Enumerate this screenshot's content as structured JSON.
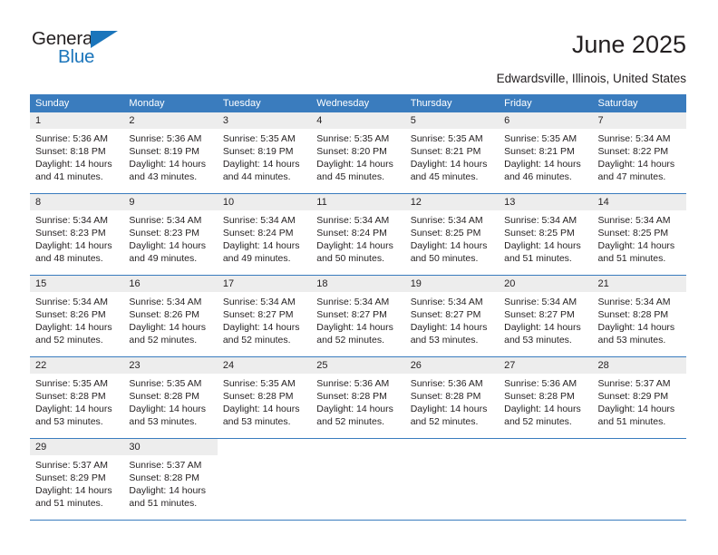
{
  "brand": {
    "name_dark": "General",
    "name_blue": "Blue",
    "accent_color": "#1b75bb"
  },
  "header": {
    "title": "June 2025",
    "subtitle": "Edwardsville, Illinois, United States"
  },
  "colors": {
    "header_band": "#3a7cbe",
    "day_band": "#ededed",
    "text": "#231f20",
    "separator": "#3a7cbe"
  },
  "weekdays": [
    "Sunday",
    "Monday",
    "Tuesday",
    "Wednesday",
    "Thursday",
    "Friday",
    "Saturday"
  ],
  "weeks": [
    [
      {
        "day": "1",
        "sunrise": "Sunrise: 5:36 AM",
        "sunset": "Sunset: 8:18 PM",
        "daylight_line1": "Daylight: 14 hours",
        "daylight_line2": "and 41 minutes."
      },
      {
        "day": "2",
        "sunrise": "Sunrise: 5:36 AM",
        "sunset": "Sunset: 8:19 PM",
        "daylight_line1": "Daylight: 14 hours",
        "daylight_line2": "and 43 minutes."
      },
      {
        "day": "3",
        "sunrise": "Sunrise: 5:35 AM",
        "sunset": "Sunset: 8:19 PM",
        "daylight_line1": "Daylight: 14 hours",
        "daylight_line2": "and 44 minutes."
      },
      {
        "day": "4",
        "sunrise": "Sunrise: 5:35 AM",
        "sunset": "Sunset: 8:20 PM",
        "daylight_line1": "Daylight: 14 hours",
        "daylight_line2": "and 45 minutes."
      },
      {
        "day": "5",
        "sunrise": "Sunrise: 5:35 AM",
        "sunset": "Sunset: 8:21 PM",
        "daylight_line1": "Daylight: 14 hours",
        "daylight_line2": "and 45 minutes."
      },
      {
        "day": "6",
        "sunrise": "Sunrise: 5:35 AM",
        "sunset": "Sunset: 8:21 PM",
        "daylight_line1": "Daylight: 14 hours",
        "daylight_line2": "and 46 minutes."
      },
      {
        "day": "7",
        "sunrise": "Sunrise: 5:34 AM",
        "sunset": "Sunset: 8:22 PM",
        "daylight_line1": "Daylight: 14 hours",
        "daylight_line2": "and 47 minutes."
      }
    ],
    [
      {
        "day": "8",
        "sunrise": "Sunrise: 5:34 AM",
        "sunset": "Sunset: 8:23 PM",
        "daylight_line1": "Daylight: 14 hours",
        "daylight_line2": "and 48 minutes."
      },
      {
        "day": "9",
        "sunrise": "Sunrise: 5:34 AM",
        "sunset": "Sunset: 8:23 PM",
        "daylight_line1": "Daylight: 14 hours",
        "daylight_line2": "and 49 minutes."
      },
      {
        "day": "10",
        "sunrise": "Sunrise: 5:34 AM",
        "sunset": "Sunset: 8:24 PM",
        "daylight_line1": "Daylight: 14 hours",
        "daylight_line2": "and 49 minutes."
      },
      {
        "day": "11",
        "sunrise": "Sunrise: 5:34 AM",
        "sunset": "Sunset: 8:24 PM",
        "daylight_line1": "Daylight: 14 hours",
        "daylight_line2": "and 50 minutes."
      },
      {
        "day": "12",
        "sunrise": "Sunrise: 5:34 AM",
        "sunset": "Sunset: 8:25 PM",
        "daylight_line1": "Daylight: 14 hours",
        "daylight_line2": "and 50 minutes."
      },
      {
        "day": "13",
        "sunrise": "Sunrise: 5:34 AM",
        "sunset": "Sunset: 8:25 PM",
        "daylight_line1": "Daylight: 14 hours",
        "daylight_line2": "and 51 minutes."
      },
      {
        "day": "14",
        "sunrise": "Sunrise: 5:34 AM",
        "sunset": "Sunset: 8:25 PM",
        "daylight_line1": "Daylight: 14 hours",
        "daylight_line2": "and 51 minutes."
      }
    ],
    [
      {
        "day": "15",
        "sunrise": "Sunrise: 5:34 AM",
        "sunset": "Sunset: 8:26 PM",
        "daylight_line1": "Daylight: 14 hours",
        "daylight_line2": "and 52 minutes."
      },
      {
        "day": "16",
        "sunrise": "Sunrise: 5:34 AM",
        "sunset": "Sunset: 8:26 PM",
        "daylight_line1": "Daylight: 14 hours",
        "daylight_line2": "and 52 minutes."
      },
      {
        "day": "17",
        "sunrise": "Sunrise: 5:34 AM",
        "sunset": "Sunset: 8:27 PM",
        "daylight_line1": "Daylight: 14 hours",
        "daylight_line2": "and 52 minutes."
      },
      {
        "day": "18",
        "sunrise": "Sunrise: 5:34 AM",
        "sunset": "Sunset: 8:27 PM",
        "daylight_line1": "Daylight: 14 hours",
        "daylight_line2": "and 52 minutes."
      },
      {
        "day": "19",
        "sunrise": "Sunrise: 5:34 AM",
        "sunset": "Sunset: 8:27 PM",
        "daylight_line1": "Daylight: 14 hours",
        "daylight_line2": "and 53 minutes."
      },
      {
        "day": "20",
        "sunrise": "Sunrise: 5:34 AM",
        "sunset": "Sunset: 8:27 PM",
        "daylight_line1": "Daylight: 14 hours",
        "daylight_line2": "and 53 minutes."
      },
      {
        "day": "21",
        "sunrise": "Sunrise: 5:34 AM",
        "sunset": "Sunset: 8:28 PM",
        "daylight_line1": "Daylight: 14 hours",
        "daylight_line2": "and 53 minutes."
      }
    ],
    [
      {
        "day": "22",
        "sunrise": "Sunrise: 5:35 AM",
        "sunset": "Sunset: 8:28 PM",
        "daylight_line1": "Daylight: 14 hours",
        "daylight_line2": "and 53 minutes."
      },
      {
        "day": "23",
        "sunrise": "Sunrise: 5:35 AM",
        "sunset": "Sunset: 8:28 PM",
        "daylight_line1": "Daylight: 14 hours",
        "daylight_line2": "and 53 minutes."
      },
      {
        "day": "24",
        "sunrise": "Sunrise: 5:35 AM",
        "sunset": "Sunset: 8:28 PM",
        "daylight_line1": "Daylight: 14 hours",
        "daylight_line2": "and 53 minutes."
      },
      {
        "day": "25",
        "sunrise": "Sunrise: 5:36 AM",
        "sunset": "Sunset: 8:28 PM",
        "daylight_line1": "Daylight: 14 hours",
        "daylight_line2": "and 52 minutes."
      },
      {
        "day": "26",
        "sunrise": "Sunrise: 5:36 AM",
        "sunset": "Sunset: 8:28 PM",
        "daylight_line1": "Daylight: 14 hours",
        "daylight_line2": "and 52 minutes."
      },
      {
        "day": "27",
        "sunrise": "Sunrise: 5:36 AM",
        "sunset": "Sunset: 8:28 PM",
        "daylight_line1": "Daylight: 14 hours",
        "daylight_line2": "and 52 minutes."
      },
      {
        "day": "28",
        "sunrise": "Sunrise: 5:37 AM",
        "sunset": "Sunset: 8:29 PM",
        "daylight_line1": "Daylight: 14 hours",
        "daylight_line2": "and 51 minutes."
      }
    ],
    [
      {
        "day": "29",
        "sunrise": "Sunrise: 5:37 AM",
        "sunset": "Sunset: 8:29 PM",
        "daylight_line1": "Daylight: 14 hours",
        "daylight_line2": "and 51 minutes."
      },
      {
        "day": "30",
        "sunrise": "Sunrise: 5:37 AM",
        "sunset": "Sunset: 8:28 PM",
        "daylight_line1": "Daylight: 14 hours",
        "daylight_line2": "and 51 minutes."
      },
      {
        "day": "",
        "sunrise": "",
        "sunset": "",
        "daylight_line1": "",
        "daylight_line2": ""
      },
      {
        "day": "",
        "sunrise": "",
        "sunset": "",
        "daylight_line1": "",
        "daylight_line2": ""
      },
      {
        "day": "",
        "sunrise": "",
        "sunset": "",
        "daylight_line1": "",
        "daylight_line2": ""
      },
      {
        "day": "",
        "sunrise": "",
        "sunset": "",
        "daylight_line1": "",
        "daylight_line2": ""
      },
      {
        "day": "",
        "sunrise": "",
        "sunset": "",
        "daylight_line1": "",
        "daylight_line2": ""
      }
    ]
  ]
}
